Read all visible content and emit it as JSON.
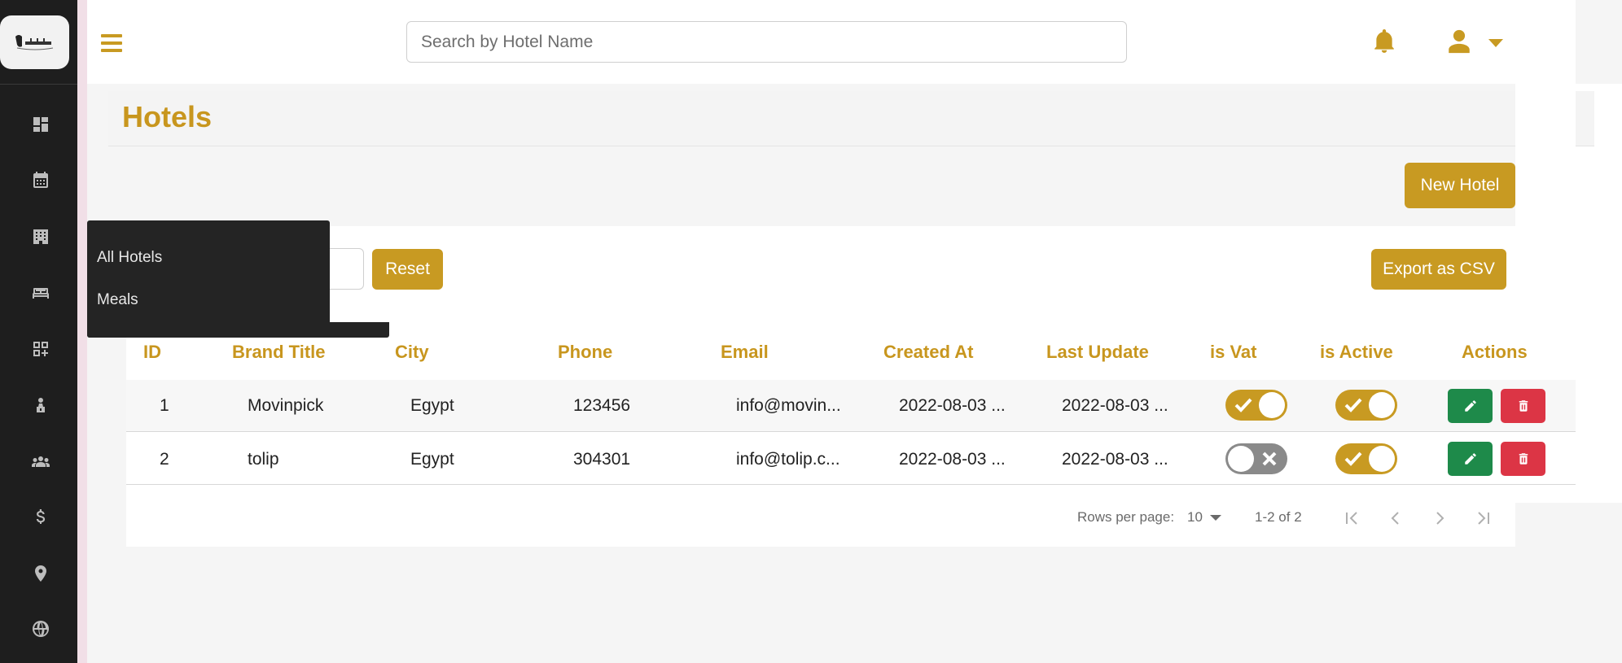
{
  "search": {
    "placeholder": "Search by Hotel Name"
  },
  "page": {
    "title": "Hotels"
  },
  "toolbar": {
    "new_hotel": "New Hotel",
    "reset": "Reset",
    "export": "Export as CSV"
  },
  "sidebar": {
    "icons": [
      "dashboard-icon",
      "calendar-icon",
      "hotel-icon",
      "bed-icon",
      "widgets-icon",
      "person-icon",
      "group-icon",
      "dollar-icon",
      "location-pin-icon",
      "globe-icon"
    ],
    "flyout": [
      "All Hotels",
      "Meals"
    ]
  },
  "table": {
    "headers": [
      "ID",
      "Brand Title",
      "City",
      "Phone",
      "Email",
      "Created At",
      "Last Update",
      "is Vat",
      "is Active",
      "Actions"
    ],
    "rows": [
      {
        "id": "1",
        "brand": "Movinpick",
        "city": "Egypt",
        "phone": "123456",
        "email": "info@movin...",
        "created": "2022-08-03 ...",
        "updated": "2022-08-03 ...",
        "is_vat": true,
        "is_active": true
      },
      {
        "id": "2",
        "brand": "tolip",
        "city": "Egypt",
        "phone": "304301",
        "email": "info@tolip.c...",
        "created": "2022-08-03 ...",
        "updated": "2022-08-03 ...",
        "is_vat": false,
        "is_active": true
      }
    ]
  },
  "pagination": {
    "rows_label": "Rows per page:",
    "rows_value": "10",
    "range": "1-2 of 2"
  },
  "colors": {
    "accent": "#c89a22",
    "sidebar": "#1e1e1e",
    "edit": "#1e8a4a",
    "delete": "#dc3545"
  }
}
